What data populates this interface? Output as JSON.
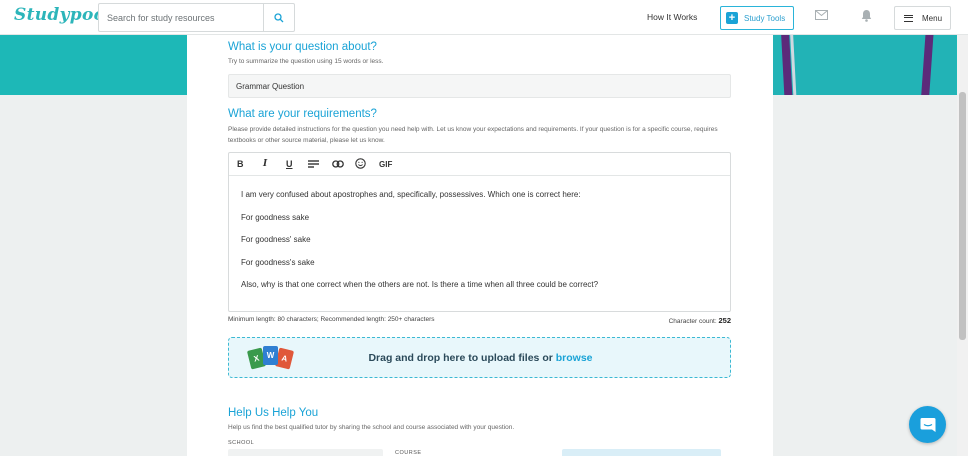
{
  "header": {
    "logo": "Studypool",
    "search_placeholder": "Search for study resources",
    "how_it_works": "How It Works",
    "study_tools": "Study Tools",
    "menu": "Menu"
  },
  "form": {
    "question_heading": "What is your question about?",
    "question_hint": "Try to summarize the question using 15 words or less.",
    "question_value": "Grammar Question",
    "requirements_heading": "What are your requirements?",
    "requirements_hint": "Please provide detailed instructions for the question you need help with. Let us know your expectations and requirements. If your question is for a specific course, requires textbooks or other source material, please let us know.",
    "toolbar": {
      "bold": "B",
      "italic": "I",
      "underline": "U",
      "gif": "GIF"
    },
    "editor_paragraphs": [
      "I am very confused about apostrophes and, specifically, possessives. Which one is correct here:",
      "For goodness sake",
      "For goodness' sake",
      "For goodness's sake",
      "Also, why is that one correct when the others are not. Is there a time when all three could be correct?"
    ],
    "length_note": "Minimum length: 80 characters; Recommended length: 250+ characters",
    "char_count_label": "Character count:",
    "char_count": "252",
    "dropzone_text": "Drag and drop here to upload files or ",
    "dropzone_link": "browse",
    "file_icons": {
      "excel": "X",
      "word": "W",
      "pdf": "A"
    },
    "help_heading": "Help Us Help You",
    "help_hint": "Help us find the best qualified tutor by sharing the school and course associated with your question.",
    "school_label": "SCHOOL",
    "course_label": "COURSE"
  },
  "colors": {
    "brand": "#1aa3d6",
    "teal_band": "#1db8b7",
    "page_bg": "#edf0f0"
  }
}
